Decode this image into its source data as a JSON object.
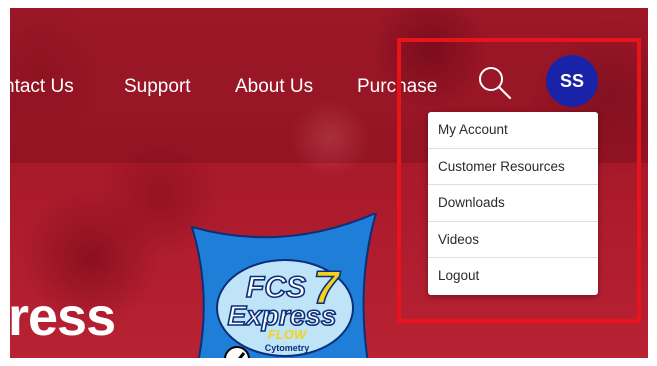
{
  "nav": {
    "items": [
      "ntact Us",
      "Support",
      "About Us",
      "Purchase"
    ]
  },
  "header": {
    "search_icon": "search-icon",
    "avatar_initials": "SS",
    "avatar_color": "#1a23a8"
  },
  "user_menu": {
    "items": [
      "My Account",
      "Customer Resources",
      "Downloads",
      "Videos",
      "Logout"
    ]
  },
  "hero": {
    "title_partial": "ress"
  },
  "product_logo": {
    "line1": "FCS",
    "version": "7",
    "line2": "Express",
    "line3": "FLOW",
    "line4": "Cytometry"
  },
  "colors": {
    "background": "#b21d2e",
    "highlight_border": "#e8141c",
    "logo_blue": "#1f7fd8",
    "version_yellow": "#f5d21a"
  }
}
